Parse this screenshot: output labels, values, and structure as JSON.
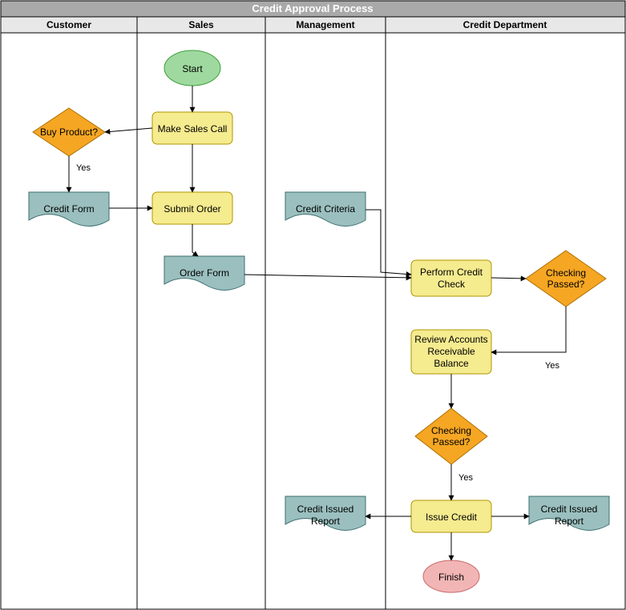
{
  "title": "Credit Approval Process",
  "lanes": [
    {
      "name": "Customer"
    },
    {
      "name": "Sales"
    },
    {
      "name": "Management"
    },
    {
      "name": "Credit Department"
    }
  ],
  "nodes": {
    "start": {
      "label": "Start"
    },
    "makeSalesCall": {
      "label": "Make Sales Call"
    },
    "buyProduct": {
      "label": "Buy Product?"
    },
    "creditForm": {
      "label": "Credit Form"
    },
    "submitOrder": {
      "label": "Submit Order"
    },
    "orderForm": {
      "label": "Order Form"
    },
    "creditCriteria": {
      "label": "Credit Criteria"
    },
    "performCreditCheck": {
      "label1": "Perform Credit",
      "label2": "Check"
    },
    "checkingPassed1": {
      "label1": "Checking",
      "label2": "Passed?"
    },
    "reviewAR": {
      "label1": "Review Accounts",
      "label2": "Receivable",
      "label3": "Balance"
    },
    "checkingPassed2": {
      "label1": "Checking",
      "label2": "Passed?"
    },
    "issueCredit": {
      "label": "Issue Credit"
    },
    "creditIssuedReport1": {
      "label1": "Credit Issued",
      "label2": "Report"
    },
    "creditIssuedReport2": {
      "label1": "Credit Issued",
      "label2": "Report"
    },
    "finish": {
      "label": "Finish"
    }
  },
  "edgeLabels": {
    "buyProductYes": "Yes",
    "checkingPassed1Yes": "Yes",
    "checkingPassed2Yes": "Yes"
  }
}
